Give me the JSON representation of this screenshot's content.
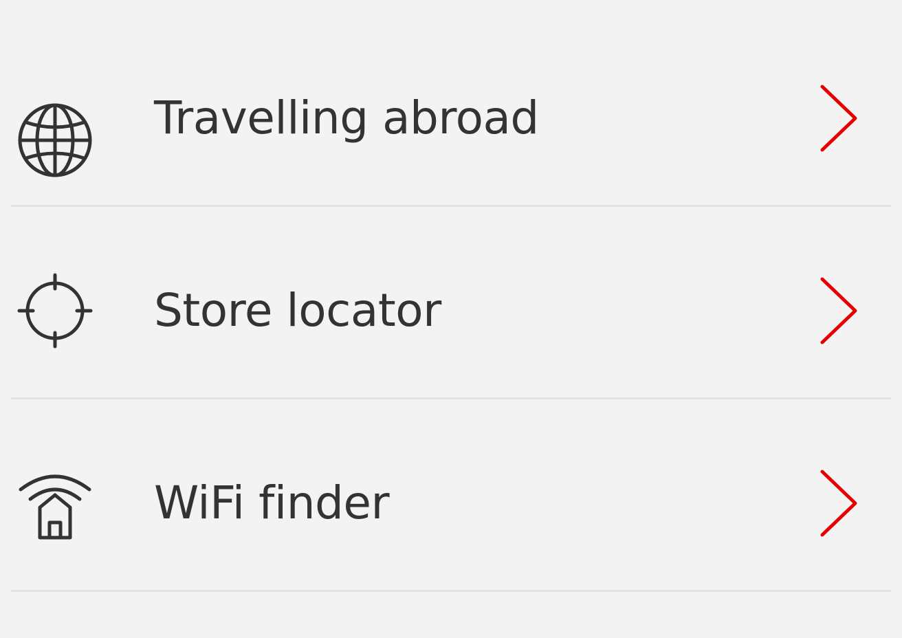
{
  "theme": {
    "background": "#f3f3f3",
    "text_color": "#333333",
    "chevron_color": "#e60000",
    "divider_color": "#e4e4e4"
  },
  "menu": {
    "items": [
      {
        "label": "Travelling abroad",
        "icon": "globe-icon"
      },
      {
        "label": "Store locator",
        "icon": "crosshair-icon"
      },
      {
        "label": "WiFi finder",
        "icon": "wifi-home-icon"
      }
    ]
  }
}
